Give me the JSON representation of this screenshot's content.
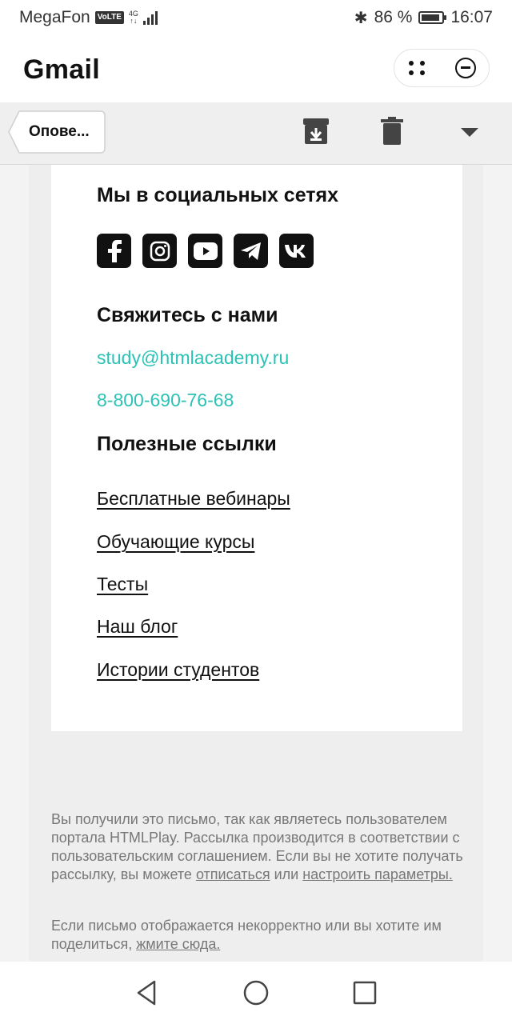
{
  "status": {
    "carrier": "MegaFon",
    "volte": "VoLTE",
    "network": "4G",
    "battery": "86 %",
    "time": "16:07"
  },
  "app": {
    "title": "Gmail"
  },
  "toolbar": {
    "back_label": "Опове..."
  },
  "email": {
    "social_heading": "Мы в социальных сетях",
    "social_icons": [
      "facebook-icon",
      "instagram-icon",
      "youtube-icon",
      "telegram-icon",
      "vk-icon"
    ],
    "contact_heading": "Свяжитесь с нами",
    "contact_email": "study@htmlacademy.ru",
    "contact_phone": "8-800-690-76-68",
    "links_heading": "Полезные ссылки",
    "links": [
      "Бесплатные вебинары",
      "Обучающие курсы",
      "Тесты",
      "Наш блог",
      "Истории студентов"
    ],
    "footer1_prefix": "Вы получили это письмо, так как являетесь пользователем портала HTMLPlay. Рассылка производится в соответствии с пользовательским соглашением. Если вы не хотите получать рассылку, вы можете ",
    "unsubscribe": "отписаться",
    "footer1_mid": " или ",
    "settings": "настроить параметры.",
    "footer2_prefix": "Если письмо отображается некорректно или вы хотите им поделиться, ",
    "click_here": "жмите сюда."
  },
  "colors": {
    "accent": "#2bc2b6",
    "toolbar_bg": "#efefef"
  }
}
